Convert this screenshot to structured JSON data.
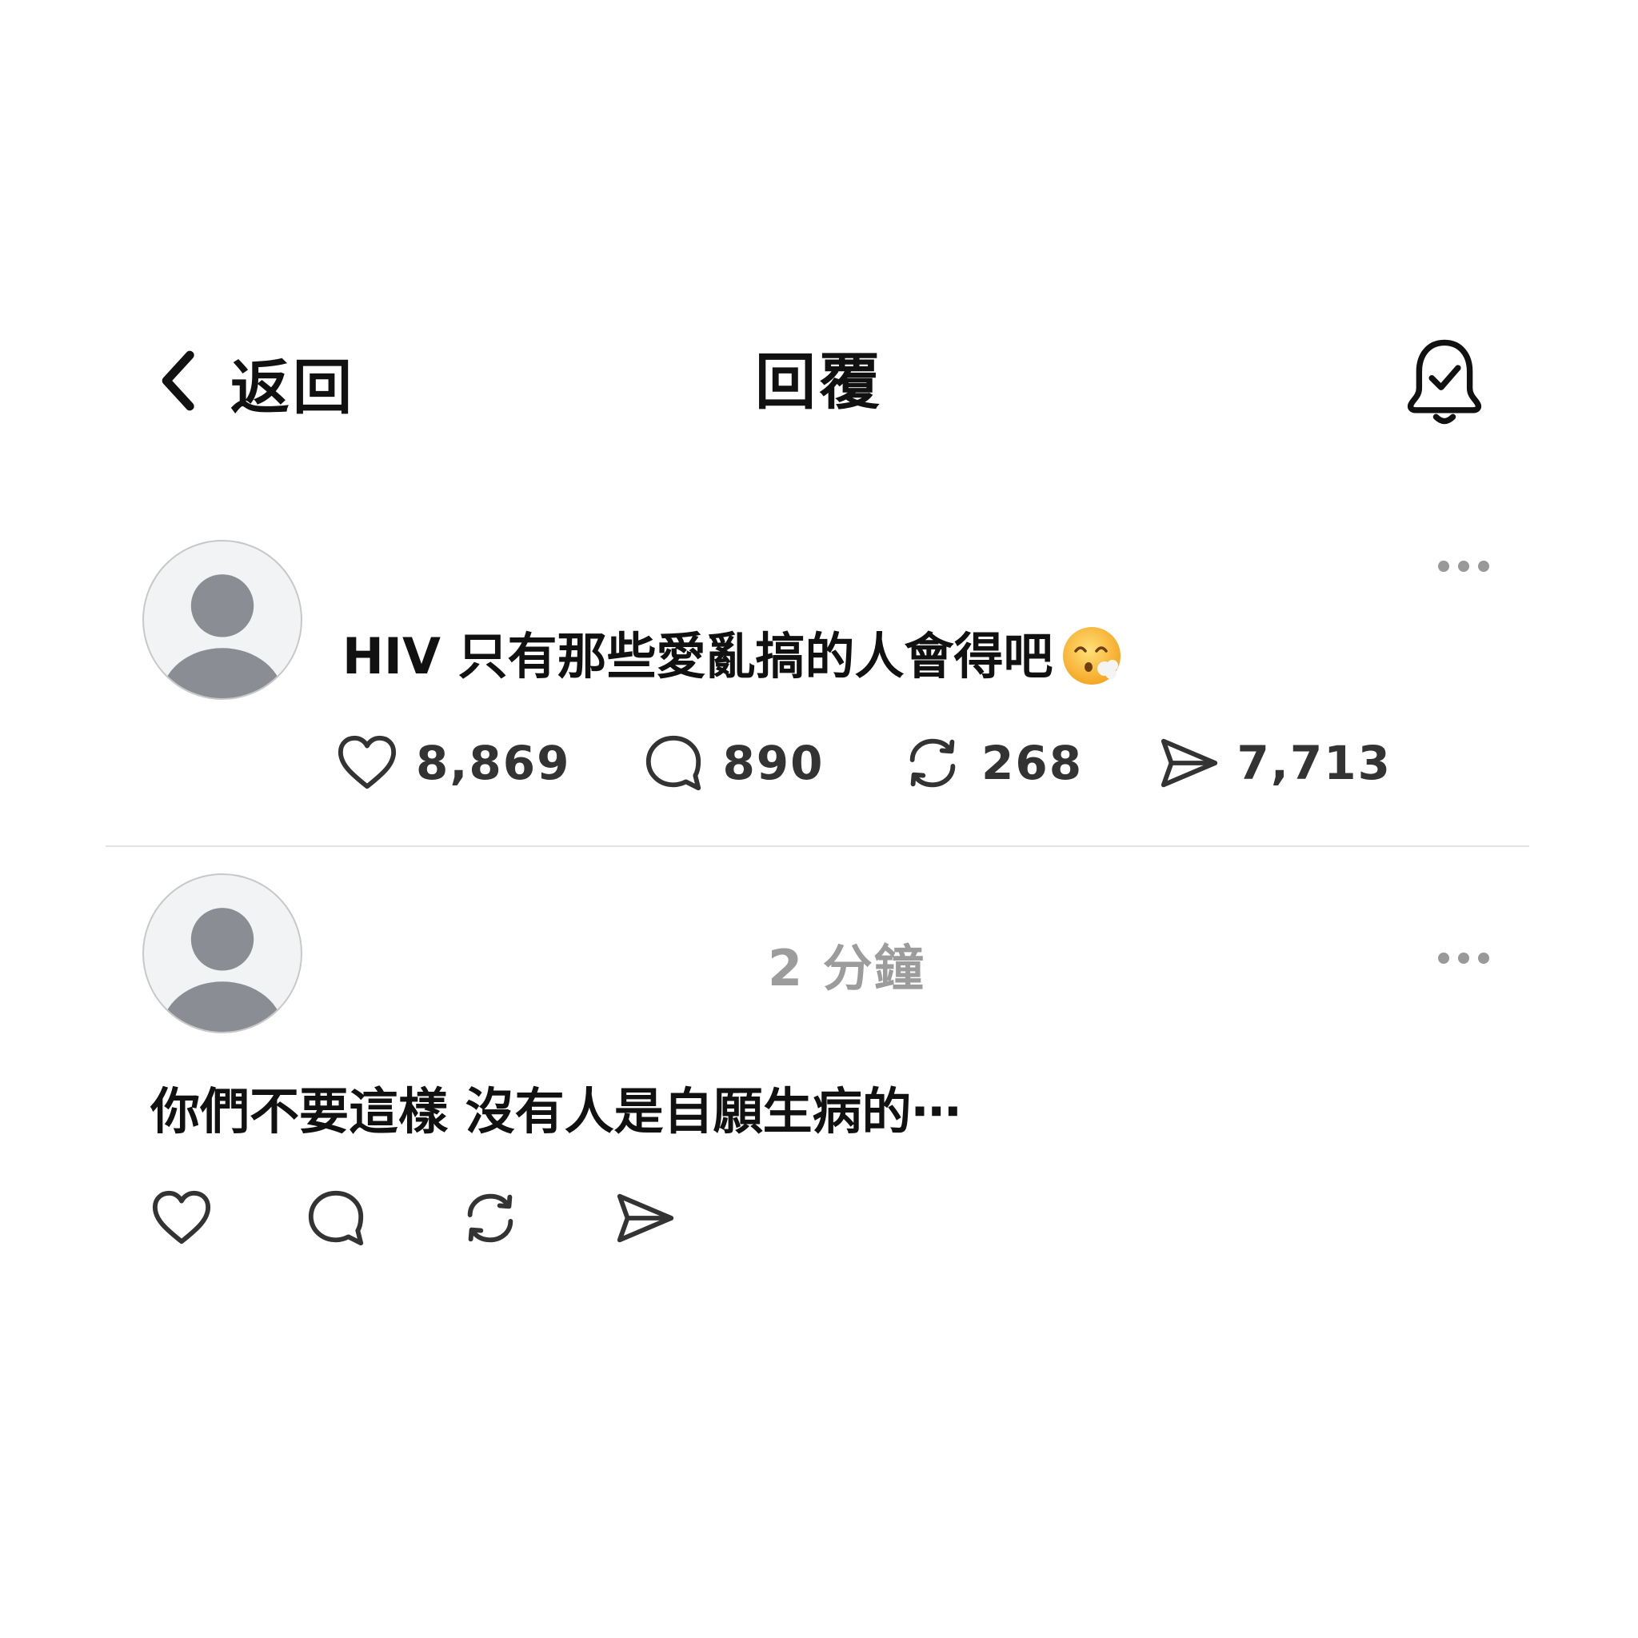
{
  "header": {
    "back_label": "返回",
    "title": "回覆"
  },
  "post": {
    "text": "HIV 只有那些愛亂搞的人會得吧",
    "emoji": "face-exhaling-emoji",
    "stats": {
      "likes": "8,869",
      "comments": "890",
      "reposts": "268",
      "shares": "7,713"
    }
  },
  "reply": {
    "timestamp": "2 分鐘",
    "text": "你們不要這樣 沒有人是自願生病的⋯"
  },
  "icons": {
    "back": "chevron-left-icon",
    "bell": "bell-check-icon",
    "more": "more-dots-icon",
    "like": "heart-icon",
    "comment": "comment-bubble-icon",
    "repost": "repost-icon",
    "share": "send-icon"
  },
  "colors": {
    "text": "#111111",
    "muted": "#9c9c9c",
    "icon": "#333333",
    "avatar_bg": "#f1f3f4",
    "avatar_fg": "#8a8d94",
    "divider": "#e3e3e3"
  }
}
